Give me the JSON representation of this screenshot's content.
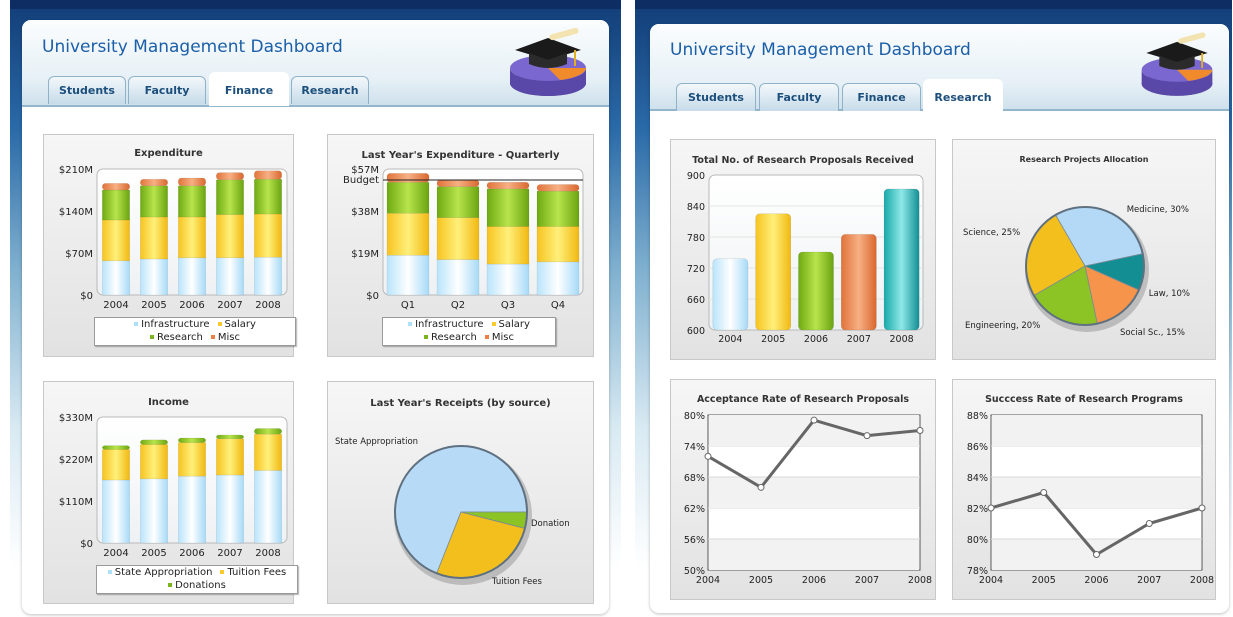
{
  "finance": {
    "app_title": "University Management Dashboard",
    "tabs": [
      {
        "label": "Students"
      },
      {
        "label": "Faculty"
      },
      {
        "label": "Finance"
      },
      {
        "label": "Research"
      }
    ],
    "active_tab": "Finance"
  },
  "research": {
    "app_title": "University Management Dashboard",
    "tabs": [
      {
        "label": "Students"
      },
      {
        "label": "Faculty"
      },
      {
        "label": "Finance"
      },
      {
        "label": "Research"
      }
    ],
    "active_tab": "Research"
  },
  "colors": {
    "infrastructure": "#d8efff",
    "salary": "#f8d630",
    "research": "#8cc425",
    "misc": "#f0905a",
    "line": "#666666"
  },
  "chart_data": [
    {
      "id": "expenditure",
      "type": "bar",
      "title": "Expenditure",
      "categories": [
        "2004",
        "2005",
        "2006",
        "2007",
        "2008"
      ],
      "stacked": true,
      "yticks": [
        "$0",
        "$70M",
        "$140M",
        "$210M"
      ],
      "ylim": [
        0,
        210
      ],
      "series": [
        {
          "name": "Infrastructure",
          "values": [
            57,
            60,
            62,
            62,
            63
          ]
        },
        {
          "name": "Salary",
          "values": [
            68,
            70,
            68,
            72,
            72
          ]
        },
        {
          "name": "Research",
          "values": [
            50,
            52,
            52,
            58,
            58
          ]
        },
        {
          "name": "Misc",
          "values": [
            11,
            11,
            13,
            12,
            14
          ]
        }
      ]
    },
    {
      "id": "quarterly",
      "type": "bar",
      "title": "Last Year's Expenditure - Quarterly",
      "categories": [
        "Q1",
        "Q2",
        "Q3",
        "Q4"
      ],
      "stacked": true,
      "yticks": [
        "$0",
        "$19M",
        "$38M",
        "$57M"
      ],
      "ylim": [
        0,
        57
      ],
      "budget": {
        "label": "Budget",
        "value": 52
      },
      "series": [
        {
          "name": "Infrastructure",
          "values": [
            18,
            16,
            14,
            15
          ]
        },
        {
          "name": "Salary",
          "values": [
            19,
            19,
            17,
            16
          ]
        },
        {
          "name": "Research",
          "values": [
            14,
            14,
            17,
            16
          ]
        },
        {
          "name": "Misc",
          "values": [
            4,
            3,
            3,
            3
          ]
        }
      ]
    },
    {
      "id": "income",
      "type": "bar",
      "title": "Income",
      "categories": [
        "2004",
        "2005",
        "2006",
        "2007",
        "2008"
      ],
      "stacked": true,
      "yticks": [
        "$0",
        "$110M",
        "$220M",
        "$330M"
      ],
      "ylim": [
        0,
        330
      ],
      "series": [
        {
          "name": "State Appropriation",
          "values": [
            165,
            168,
            175,
            178,
            190
          ]
        },
        {
          "name": "Tuition Fees",
          "values": [
            80,
            90,
            88,
            95,
            95
          ]
        },
        {
          "name": "Donations",
          "values": [
            10,
            12,
            12,
            10,
            15
          ]
        }
      ]
    },
    {
      "id": "receipts",
      "type": "pie",
      "title": "Last Year's Receipts (by source)",
      "slices": [
        {
          "label": "State Appropriation",
          "value": 69
        },
        {
          "label": "Tuition Fees",
          "value": 27
        },
        {
          "label": "Donation",
          "value": 4
        }
      ]
    },
    {
      "id": "proposals",
      "type": "bar",
      "title": "Total No. of Research Proposals Received",
      "categories": [
        "2004",
        "2005",
        "2006",
        "2007",
        "2008"
      ],
      "yticks": [
        "600",
        "660",
        "720",
        "780",
        "840",
        "900"
      ],
      "ylim": [
        600,
        900
      ],
      "values": [
        738,
        825,
        751,
        785,
        873
      ]
    },
    {
      "id": "allocation",
      "type": "pie",
      "title": "Research Projects Allocation",
      "slices": [
        {
          "label": "Medicine, 30%",
          "value": 30
        },
        {
          "label": "Law, 10%",
          "value": 10
        },
        {
          "label": "Social Sc., 15%",
          "value": 15
        },
        {
          "label": "Engineering, 20%",
          "value": 20
        },
        {
          "label": "Science, 25%",
          "value": 25
        }
      ]
    },
    {
      "id": "acceptance",
      "type": "line",
      "title": "Acceptance Rate of Research Proposals",
      "x": [
        "2004",
        "2005",
        "2006",
        "2007",
        "2008"
      ],
      "yticks": [
        "50%",
        "56%",
        "62%",
        "68%",
        "74%",
        "80%"
      ],
      "ylim": [
        50,
        80
      ],
      "values": [
        72,
        66,
        79,
        76,
        77
      ]
    },
    {
      "id": "success",
      "type": "line",
      "title": "Succcess Rate of Research Programs",
      "x": [
        "2004",
        "2005",
        "2006",
        "2007",
        "2008"
      ],
      "yticks": [
        "78%",
        "80%",
        "82%",
        "84%",
        "86%",
        "88%"
      ],
      "ylim": [
        78,
        88
      ],
      "values": [
        82,
        83,
        79,
        81,
        82
      ]
    }
  ]
}
